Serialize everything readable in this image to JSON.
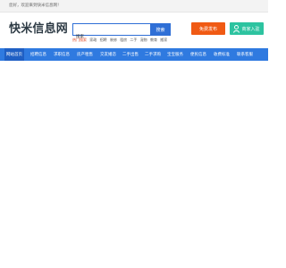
{
  "topbar": {
    "greeting": "您好，欢迎来到快米信息网！"
  },
  "header": {
    "logo": "快米信息网"
  },
  "search": {
    "value": "搜索",
    "button_label": "搜索"
  },
  "hot_search": {
    "label": "热门搜索",
    "keywords": [
      "家政",
      "招聘",
      "装修",
      "租房",
      "二手",
      "宠物",
      "教育",
      "搬家"
    ]
  },
  "actions": {
    "publish_label": "免费发布",
    "merchant_label": "商家入驻"
  },
  "nav": {
    "items": [
      "网站首页",
      "招聘信息",
      "求职信息",
      "房产租售",
      "交友婚恋",
      "二手出售",
      "二手求购",
      "宝宝服务",
      "便民信息",
      "收费标准",
      "联系客服"
    ]
  },
  "colors": {
    "brand_blue": "#2f6fd6",
    "nav_blue": "#2f7ae0",
    "publish_orange": "#f05a14",
    "merchant_green": "#2dc3a0"
  }
}
